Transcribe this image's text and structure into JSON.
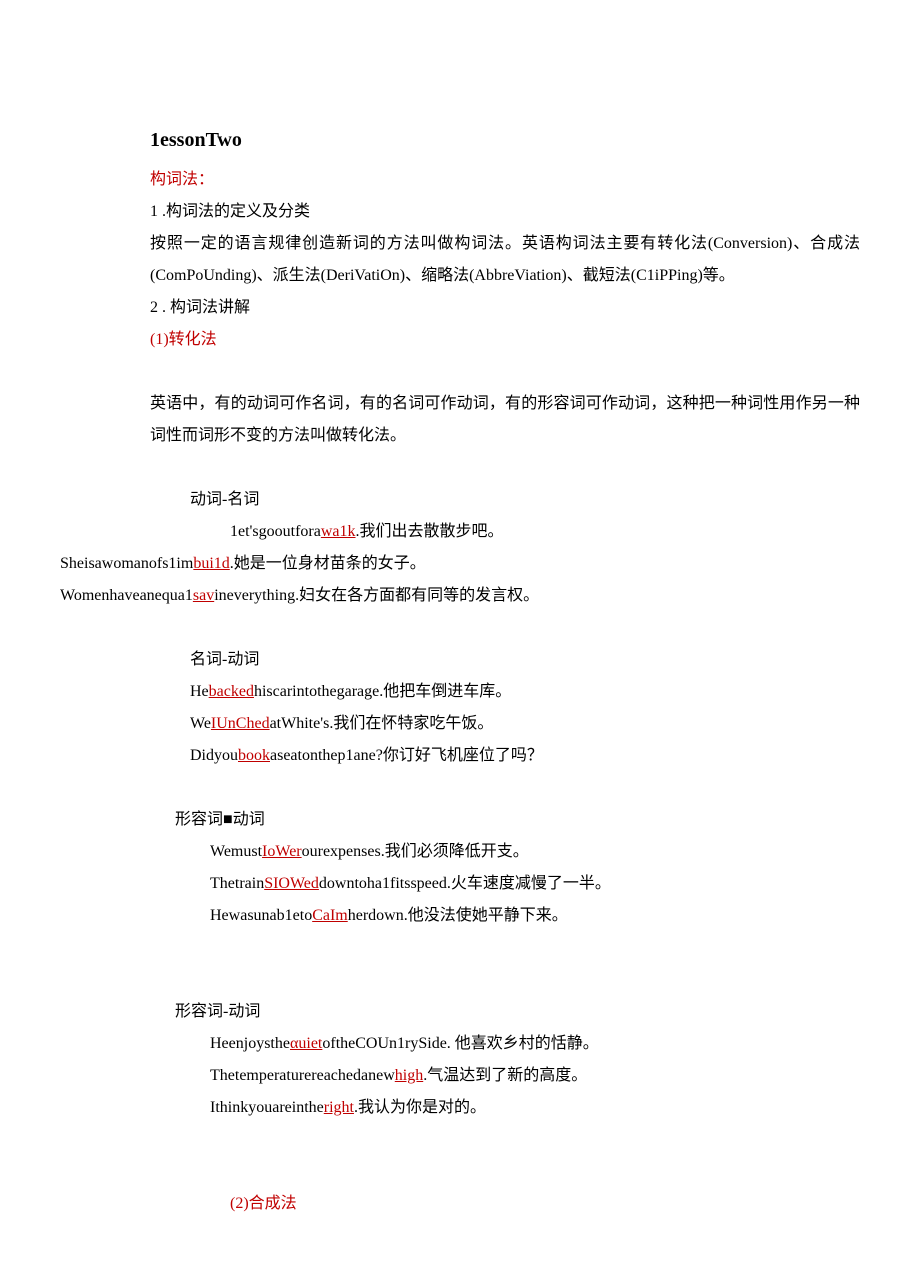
{
  "title": "1essonTwo",
  "section_head": "构词法：",
  "p1_num": "1 .构词法的定义及分类",
  "p1_body": "按照一定的语言规律创造新词的方法叫做构词法。英语构词法主要有转化法(Conversion)、合成法(ComPoUnding)、派生法(DeriVatiOn)、缩略法(AbbreViation)、截短法(C1iPPing)等。",
  "p2_num": "2 . 构词法讲解",
  "sub1_head": "(1)转化法",
  "p3_body": "英语中，有的动词可作名词，有的名词可作动词，有的形容词可作动词，这种把一种词性用作另一种词性而词形不变的方法叫做转化法。",
  "cat1": "动词-名词",
  "ex1_a": "1et'sgooutfora",
  "ex1_u": "wa1k",
  "ex1_b": ".我们出去散散步吧。",
  "ex2_a": "Sheisawomanofs1im",
  "ex2_u": "bui1d",
  "ex2_b": ".她是一位身材苗条的女子。",
  "ex3_a": "Womenhaveanequa1",
  "ex3_u": "sav",
  "ex3_b": "ineverything.妇女在各方面都有同等的发言权。",
  "cat2": "名词-动词",
  "ex4_a": "He",
  "ex4_u": "backed",
  "ex4_b": "hiscarintothegarage.他把车倒进车库。",
  "ex5_a": "We",
  "ex5_u": "IUnChed",
  "ex5_b": "atWhite's.我们在怀特家吃午饭。",
  "ex6_a": "Didyou",
  "ex6_u": "book",
  "ex6_b": "aseatonthep1ane?你订好飞机座位了吗？",
  "cat3_a": "形容词",
  "cat3_sq": "■",
  "cat3_b": "动词",
  "ex7_a": "Wemust",
  "ex7_u": "IoWer",
  "ex7_b": "ourexpenses.我们必须降低开支。",
  "ex8_a": "Thetrain",
  "ex8_u": "SIOWed",
  "ex8_b": "downtoha1fitsspeed.火车速度减慢了一半。",
  "ex9_a": "Hewasunab1eto",
  "ex9_u": "CaIm",
  "ex9_b": "herdown.他没法使她平静下来。",
  "cat4": "形容词-动词",
  "ex10_a": "Heenjoysthe",
  "ex10_u": "αuiet",
  "ex10_b": "oftheCOUn1rySide. 他喜欢乡村的恬静。",
  "ex11_a": "Thetemperaturereachedanew",
  "ex11_u": "high",
  "ex11_b": ".气温达到了新的高度。",
  "ex12_a": "Ithinkyouareinthe",
  "ex12_u": "right",
  "ex12_b": ".我认为你是对的。",
  "sub2_head": "(2)合成法"
}
